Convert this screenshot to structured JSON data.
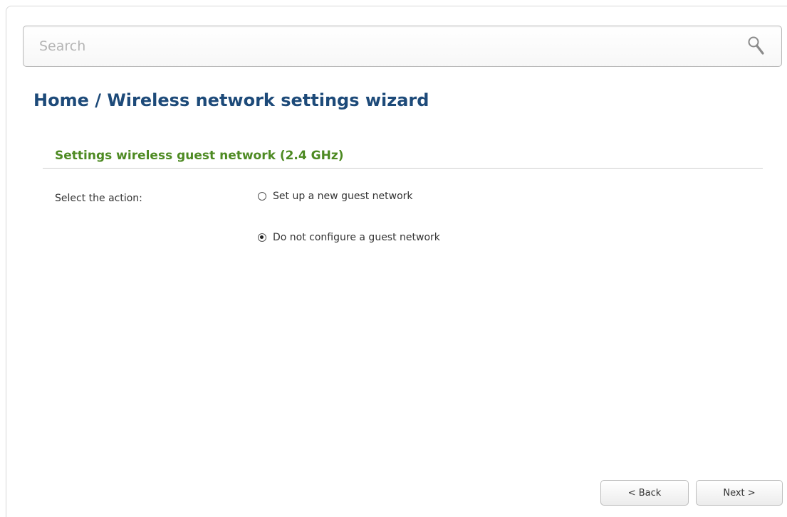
{
  "search": {
    "placeholder": "Search",
    "value": ""
  },
  "breadcrumb": {
    "title": "Home /  Wireless network settings wizard"
  },
  "section": {
    "title": "Settings wireless guest network (2.4 GHz)"
  },
  "form": {
    "action_label": "Select the action:",
    "options": [
      {
        "label": "Set up a new guest network",
        "selected": false
      },
      {
        "label": "Do not configure a guest network",
        "selected": true
      }
    ]
  },
  "buttons": {
    "back": "< Back",
    "next": "Next >"
  },
  "colors": {
    "title": "#1d4a79",
    "section_title": "#4d8a22"
  },
  "icons": {
    "search": "search-icon"
  }
}
